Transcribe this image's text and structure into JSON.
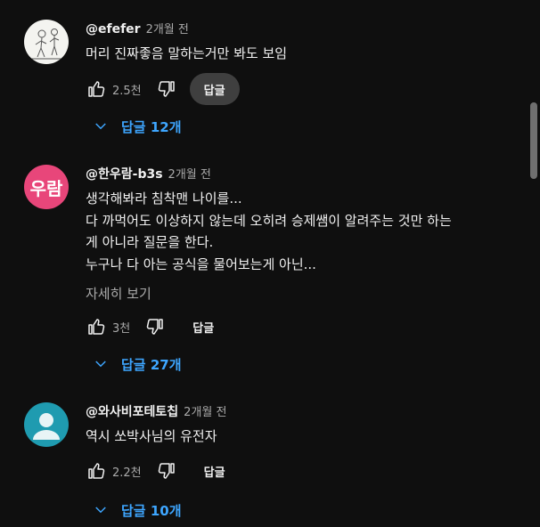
{
  "comments": [
    {
      "author": "@efefer",
      "time": "2개월 전",
      "text": "머리 진짜좋음 말하는거만 봐도 보임",
      "likes": "2.5천",
      "reply_label": "답글",
      "replies_label": "답글 12개",
      "avatar_type": "sketch",
      "reply_hover": true
    },
    {
      "author": "@한우람-b3s",
      "time": "2개월 전",
      "avatar_text": "우람",
      "avatar_color": "#e8467a",
      "text": "생각해봐라 침착맨 나이를...\n다 까먹어도 이상하지 않는데 오히려 승제쌤이 알려주는 것만 하는\n게 아니라 질문을 한다.\n누구나 다 아는 공식을 물어보는게 아닌...",
      "more_label": "자세히 보기",
      "likes": "3천",
      "reply_label": "답글",
      "replies_label": "답글 27개"
    },
    {
      "author": "@와사비포테토칩",
      "time": "2개월 전",
      "text": "역시 쏘박사님의 유전자",
      "likes": "2.2천",
      "reply_label": "답글",
      "replies_label": "답글 10개",
      "avatar_type": "default",
      "avatar_color": "#1f9bb0"
    }
  ],
  "icons": {
    "like": "thumbs-up-icon",
    "dislike": "thumbs-down-icon",
    "expand": "chevron-down-icon"
  },
  "colors": {
    "background": "#0f0f0f",
    "text": "#f1f1f1",
    "secondary": "#aaaaaa",
    "link": "#3ea6ff"
  }
}
